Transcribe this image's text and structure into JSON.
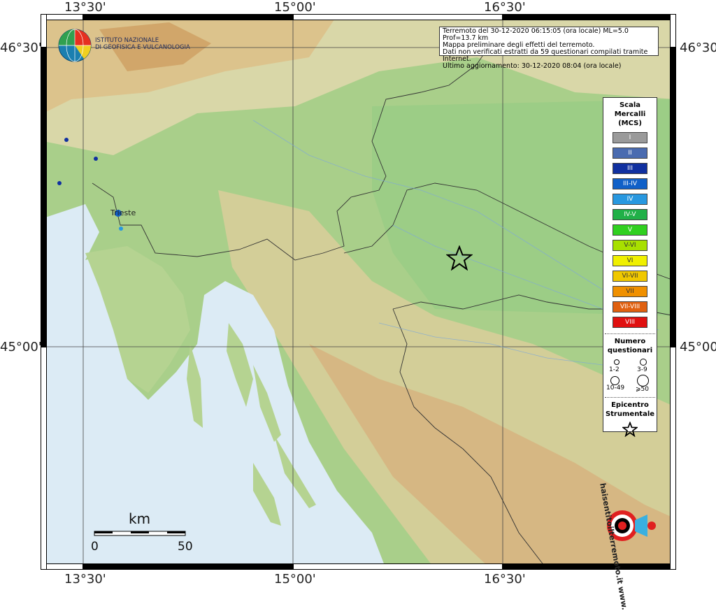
{
  "map": {
    "lon_labels": [
      "13°30'",
      "15°00'",
      "16°30'"
    ],
    "lat_labels": [
      "46°30'",
      "45°00'"
    ],
    "city_label": "Trieste"
  },
  "logo": {
    "line1": "ISTITUTO NAZIONALE",
    "line2": "DI GEOFISICA E VULCANOLOGIA"
  },
  "info": {
    "line1": "Terremoto del 30-12-2020 06:15:05 (ora locale) ML=5.0 Prof=13.7 km",
    "line2": "Mappa preliminare degli effetti del terremoto.",
    "line3": "Dati non verificati estratti da 59 questionari compilati tramite Internet.",
    "line4": "Ultimo aggiornamento: 30-12-2020 08:04 (ora locale)"
  },
  "legend": {
    "title1": "Scala",
    "title2": "Mercalli",
    "title3": "(MCS)",
    "levels": [
      {
        "label": "I",
        "color": "#9a9a9a"
      },
      {
        "label": "II",
        "color": "#4a6bb0"
      },
      {
        "label": "III",
        "color": "#1030a0"
      },
      {
        "label": "III-IV",
        "color": "#1060c8"
      },
      {
        "label": "IV",
        "color": "#2898e0"
      },
      {
        "label": "IV-V",
        "color": "#20b048"
      },
      {
        "label": "V",
        "color": "#30d020"
      },
      {
        "label": "V-VI",
        "color": "#a8e000"
      },
      {
        "label": "VI",
        "color": "#f0f000"
      },
      {
        "label": "VI-VII",
        "color": "#f0c800"
      },
      {
        "label": "VII",
        "color": "#f09000"
      },
      {
        "label": "VII-VIII",
        "color": "#e06010"
      },
      {
        "label": "VIII",
        "color": "#e01010"
      }
    ],
    "count_title1": "Numero",
    "count_title2": "questionari",
    "count_1": "1-2",
    "count_2": "3-9",
    "count_3": "10-49",
    "count_4": "⩾50",
    "epi_title1": "Epicentro",
    "epi_title2": "Strumentale"
  },
  "scale": {
    "unit": "km",
    "start": "0",
    "end": "50"
  },
  "watermark": {
    "text": "haisentitoilterremoto.it  www."
  }
}
